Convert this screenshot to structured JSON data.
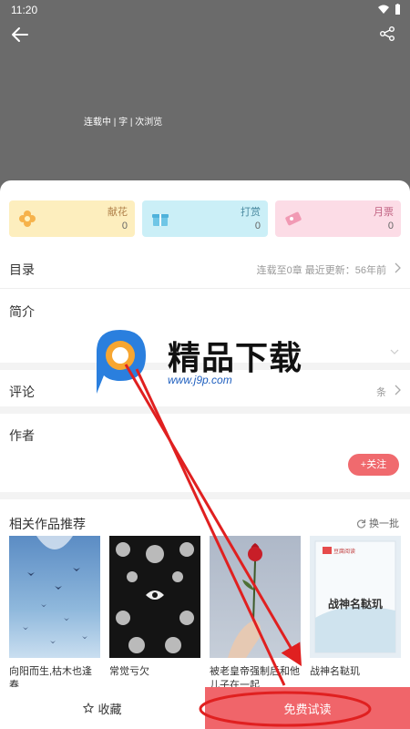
{
  "status": {
    "time": "11:20"
  },
  "book": {
    "meta": "连载中 | 字 | 次浏览"
  },
  "rewards": [
    {
      "label": "献花",
      "count": "0"
    },
    {
      "label": "打赏",
      "count": "0"
    },
    {
      "label": "月票",
      "count": "0"
    }
  ],
  "catalog": {
    "title": "目录",
    "info": "连载至0章 最近更新：56年前"
  },
  "intro": {
    "title": "简介"
  },
  "comments": {
    "title": "评论",
    "count": "条"
  },
  "author": {
    "title": "作者",
    "follow_label": "+关注"
  },
  "recommend": {
    "title": "相关作品推荐",
    "refresh_label": "换一批",
    "books": [
      {
        "title": "向阳而生,枯木也逢春"
      },
      {
        "title": "常觉亏欠"
      },
      {
        "title": "被老皇帝强制后和他儿子在一起"
      },
      {
        "title": "战神名鞑玑"
      }
    ]
  },
  "cover_text": {
    "book4_title": "战神名鞑玑",
    "book4_brand": "豆腐阅读"
  },
  "bottom": {
    "favorite_label": "收藏",
    "read_label": "免费试读"
  },
  "watermark": {
    "title": "精品下载",
    "url": "www.j9p.com"
  },
  "colors": {
    "accent": "#f0656a",
    "annotation": "#e02020"
  }
}
